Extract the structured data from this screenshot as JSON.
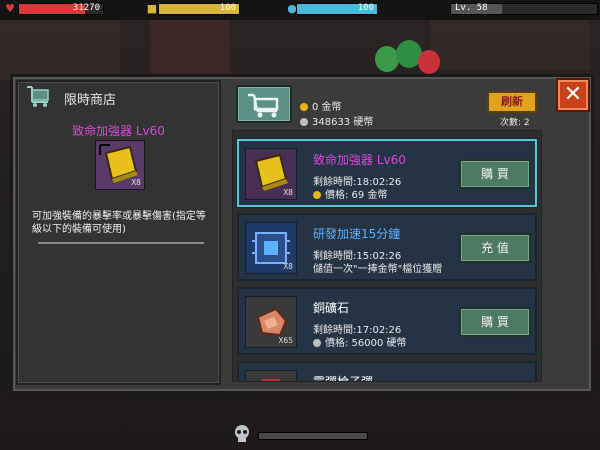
{
  "hud": {
    "hp_value": "31270",
    "hp_fill": 0.78,
    "gold_value": "100",
    "gold_fill": 1.0,
    "water_value": "100",
    "water_fill": 1.0,
    "level_label": "Lv. 58",
    "level_fill": 0.35,
    "colors": {
      "hp": "#d83a3a",
      "gold": "#d8b43a",
      "water": "#4ab8d8",
      "level": "#555555"
    }
  },
  "shop": {
    "title": "限時商店",
    "selected_item": {
      "name": "致命加強器 Lv60",
      "qty": "X8",
      "description": "可加強裝備的暴擊率或暴擊傷害(指定等級以下的裝備可使用)"
    },
    "currency": {
      "gold_amount": "0 金幣",
      "coin_amount": "348633 硬幣"
    },
    "refresh_label": "刷新",
    "refresh_count": "次數: 2",
    "items": [
      {
        "name": "致命加強器 Lv60",
        "name_color": "#d94ad9",
        "qty": "X8",
        "time": "剩餘時間:18:02:26",
        "price": "價格: 69 金幣",
        "action": "購 買",
        "icon": "yellow-enhancer-icon"
      },
      {
        "name": "研發加速15分鐘",
        "name_color": "#5fb0ff",
        "qty": "X8",
        "time": "剩餘時間:15:02:26",
        "price": "儲值一次\"一捧金幣\"檔位獲贈",
        "action": "充 值",
        "icon": "research-chip-icon"
      },
      {
        "name": "銅礦石",
        "name_color": "#ffffff",
        "qty": "X65",
        "time": "剩餘時間:17:02:26",
        "price": "價格: 56000 硬幣",
        "action": "購 買",
        "icon": "copper-ore-icon"
      },
      {
        "name": "霰彈槍子彈",
        "name_color": "#ffffff",
        "qty": "",
        "time": "",
        "price": "",
        "action": "",
        "icon": "shotgun-shell-icon"
      }
    ]
  }
}
